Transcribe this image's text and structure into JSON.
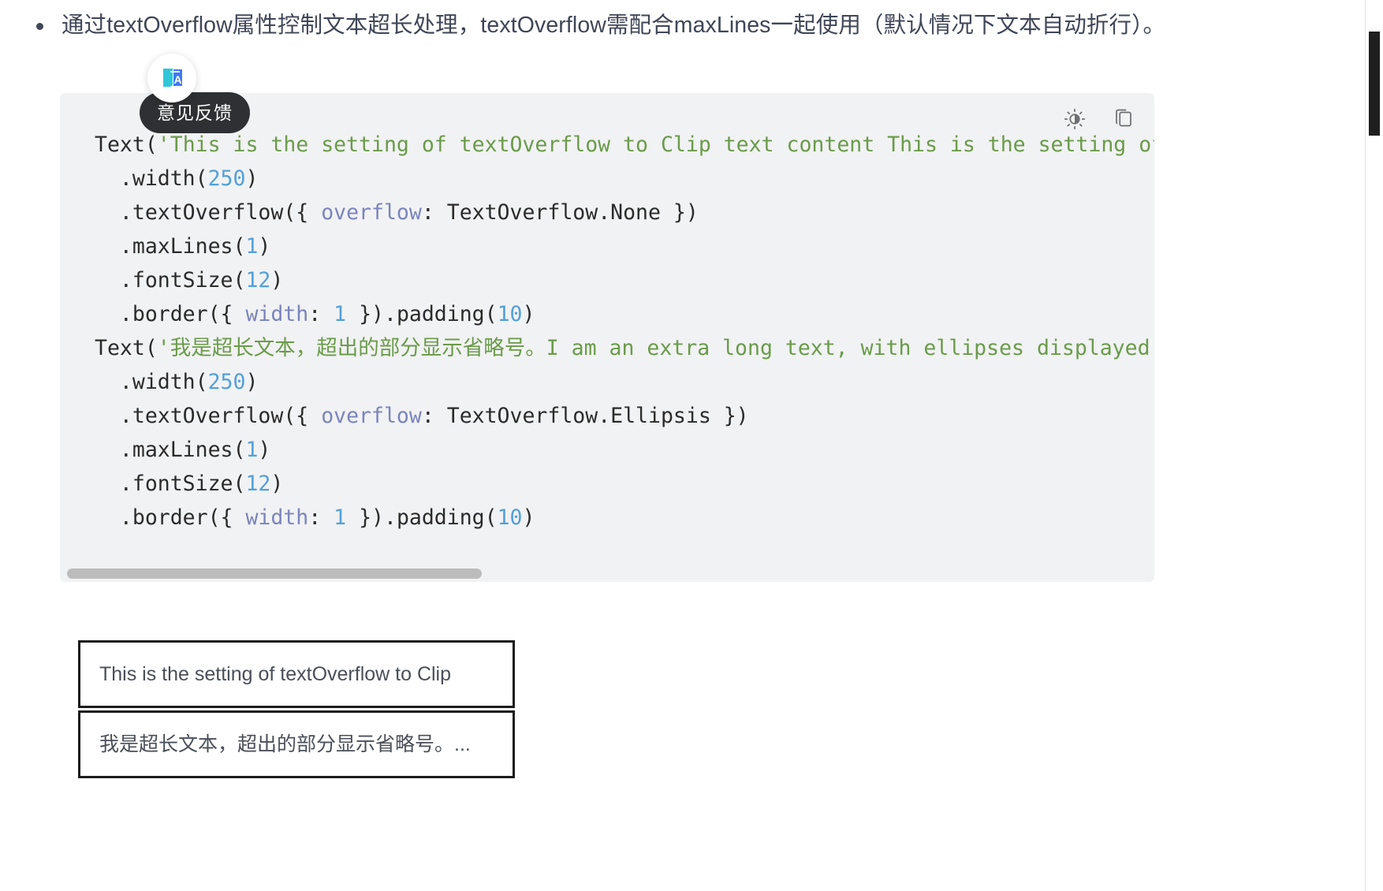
{
  "page": {
    "bullet_text": "通过textOverflow属性控制文本超长处理，textOverflow需配合maxLines一起使用（默认情况下文本自动折行）。"
  },
  "floating_widget": {
    "icon": "translate-icon",
    "tooltip_label": "意见反馈"
  },
  "code_block": {
    "language": "arkts",
    "background_color": "#f1f2f3",
    "toolbar": {
      "brightness_icon": "brightness-icon",
      "copy_icon": "copy-icon"
    },
    "lines": [
      [
        {
          "t": "Text('",
          "c": "mix-open"
        },
        {
          "t": "Text(",
          "c": "plain"
        },
        {
          "t": "'This is the setting of textOverflow to Clip text content This is the setting of tex",
          "c": "str"
        }
      ],
      [
        {
          "t": "  .width(",
          "c": "plain"
        },
        {
          "t": "250",
          "c": "num"
        },
        {
          "t": ")",
          "c": "plain"
        }
      ],
      [
        {
          "t": "  .textOverflow({ ",
          "c": "plain"
        },
        {
          "t": "overflow",
          "c": "prop"
        },
        {
          "t": ": TextOverflow.None })",
          "c": "plain"
        }
      ],
      [
        {
          "t": "  .maxLines(",
          "c": "plain"
        },
        {
          "t": "1",
          "c": "num"
        },
        {
          "t": ")",
          "c": "plain"
        }
      ],
      [
        {
          "t": "  .fontSize(",
          "c": "plain"
        },
        {
          "t": "12",
          "c": "num"
        },
        {
          "t": ")",
          "c": "plain"
        }
      ],
      [
        {
          "t": "  .border({ ",
          "c": "plain"
        },
        {
          "t": "width",
          "c": "prop"
        },
        {
          "t": ": ",
          "c": "plain"
        },
        {
          "t": "1",
          "c": "num"
        },
        {
          "t": " }).padding(",
          "c": "plain"
        },
        {
          "t": "10",
          "c": "num"
        },
        {
          "t": ")",
          "c": "plain"
        }
      ],
      [
        {
          "t": "Text(",
          "c": "plain"
        },
        {
          "t": "'我是超长文本，超出的部分显示省略号。I am an extra long text, with ellipses displayed for",
          "c": "str"
        }
      ],
      [
        {
          "t": "  .width(",
          "c": "plain"
        },
        {
          "t": "250",
          "c": "num"
        },
        {
          "t": ")",
          "c": "plain"
        }
      ],
      [
        {
          "t": "  .textOverflow({ ",
          "c": "plain"
        },
        {
          "t": "overflow",
          "c": "prop"
        },
        {
          "t": ": TextOverflow.Ellipsis })",
          "c": "plain"
        }
      ],
      [
        {
          "t": "  .maxLines(",
          "c": "plain"
        },
        {
          "t": "1",
          "c": "num"
        },
        {
          "t": ")",
          "c": "plain"
        }
      ],
      [
        {
          "t": "  .fontSize(",
          "c": "plain"
        },
        {
          "t": "12",
          "c": "num"
        },
        {
          "t": ")",
          "c": "plain"
        }
      ],
      [
        {
          "t": "  .border({ ",
          "c": "plain"
        },
        {
          "t": "width",
          "c": "prop"
        },
        {
          "t": ": ",
          "c": "plain"
        },
        {
          "t": "1",
          "c": "num"
        },
        {
          "t": " }).padding(",
          "c": "plain"
        },
        {
          "t": "10",
          "c": "num"
        },
        {
          "t": ")",
          "c": "plain"
        }
      ]
    ],
    "horizontal_scrollbar": {
      "visible": true
    }
  },
  "result_preview": {
    "box_one_text": "This is the setting of textOverflow to Clip",
    "box_two_text": "我是超长文本，超出的部分显示省略号。..."
  },
  "colors": {
    "string": "#6a9b4a",
    "number": "#54a0d8",
    "property": "#7b84bd",
    "plain": "#2b2b2b",
    "code_bg": "#f1f2f3",
    "tooltip_bg": "#2f3033",
    "body_text": "#3f4657"
  }
}
